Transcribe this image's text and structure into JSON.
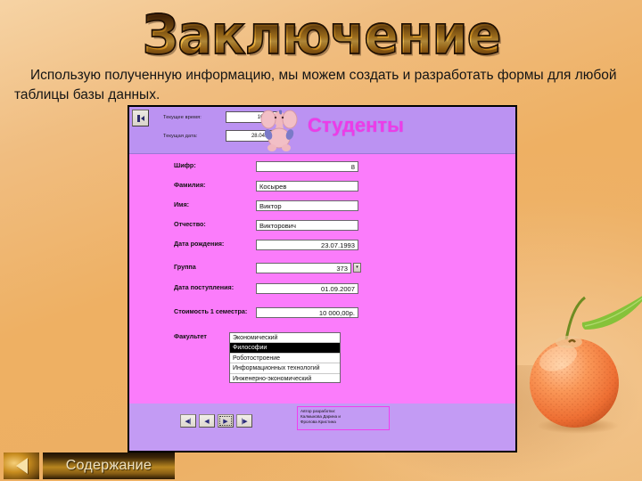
{
  "slide": {
    "title": "Заключение",
    "body_line1": "Использую полученную информацию, мы можем создать и разработать формы",
    "body_line2": "для любой таблицы базы данных."
  },
  "form": {
    "window_button_icon": "access-form-view-icon",
    "header": {
      "time_label": "Текущее время:",
      "time_value": "10:16:10",
      "date_label": "Текущая дата:",
      "date_value": "28.04.2010",
      "mascot_icon": "elephant-icon",
      "title": "Студенты",
      "title_color": "#ec3ce8"
    },
    "fields": [
      {
        "label": "Шифр:",
        "value": "8",
        "align": "num"
      },
      {
        "label": "Фамилия:",
        "value": "Косырев",
        "align": "txt"
      },
      {
        "label": "Имя:",
        "value": "Виктор",
        "align": "txt"
      },
      {
        "label": "Отчество:",
        "value": "Викторович",
        "align": "txt"
      },
      {
        "label": "Дата рождения:",
        "value": "23.07.1993",
        "align": "num"
      },
      {
        "label": "Группа",
        "value": "373",
        "align": "num",
        "spinner": true
      },
      {
        "label": "Дата поступления:",
        "value": "01.09.2007",
        "align": "num"
      },
      {
        "label": "Стоимость 1 семестра:",
        "value": "10 000,00р.",
        "align": "num"
      }
    ],
    "faculty": {
      "label": "Факультет",
      "options": [
        "Экономический",
        "Философии",
        "Роботостроение",
        "Информационных технологий",
        "Инженерно-экономический"
      ],
      "selected_index": 1
    },
    "nav": {
      "first_icon": "nav-first-record-icon",
      "prev_icon": "nav-previous-record-icon",
      "next_icon": "nav-next-record-icon",
      "last_icon": "nav-last-record-icon",
      "first_glyph": "◀|",
      "prev_glyph": "◀",
      "next_glyph": "▶",
      "last_glyph": "|▶"
    },
    "authors": {
      "line1": "Автор разработки:",
      "line2": "Калмыкова Дарина и",
      "line3": "Фролова Кристина",
      "border_color": "#f03df0"
    },
    "colors": {
      "header_bg": "#bb92f2",
      "detail_bg": "#fb7cfb",
      "footer_bg": "#c39bf4"
    }
  },
  "footer_nav": {
    "back_icon": "back-arrow-icon",
    "contents_label": "Содержание"
  }
}
